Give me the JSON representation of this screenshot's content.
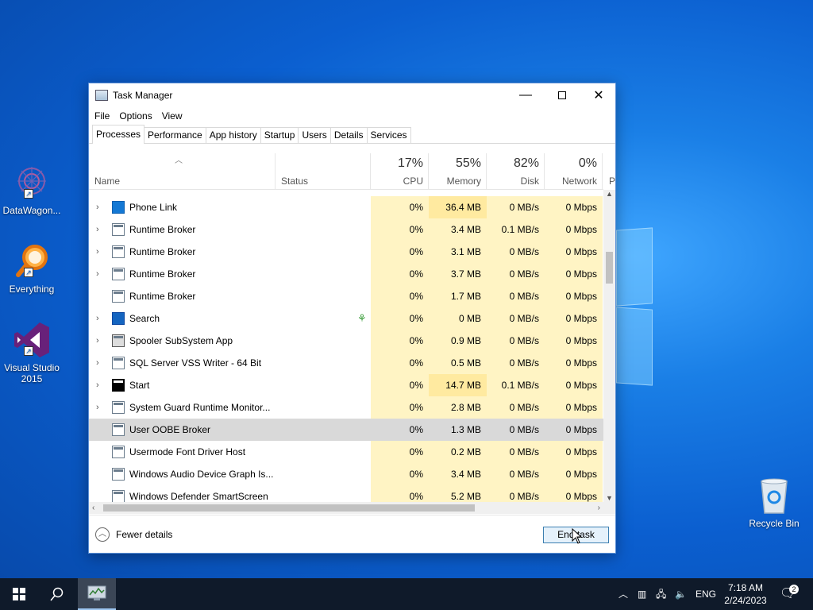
{
  "desktop": {
    "icons": [
      {
        "label": "DataWagon...",
        "icon": "datawagon-icon"
      },
      {
        "label": "Everything",
        "icon": "everything-search-icon"
      },
      {
        "label": "Visual Studio 2015",
        "icon": "visual-studio-icon"
      },
      {
        "label": "Recycle Bin",
        "icon": "recycle-bin-icon"
      }
    ]
  },
  "window": {
    "title": "Task Manager",
    "menu": [
      "File",
      "Options",
      "View"
    ],
    "tabs": [
      "Processes",
      "Performance",
      "App history",
      "Startup",
      "Users",
      "Details",
      "Services"
    ],
    "active_tab": "Processes",
    "columns": {
      "name": "Name",
      "status": "Status",
      "cpu": {
        "pct": "17%",
        "label": "CPU"
      },
      "memory": {
        "pct": "55%",
        "label": "Memory"
      },
      "disk": {
        "pct": "82%",
        "label": "Disk"
      },
      "network": {
        "pct": "0%",
        "label": "Network"
      },
      "power_partial": "P"
    },
    "rows": [
      {
        "name": "Phone Link",
        "expand": true,
        "icon": "blue",
        "cpu": "0%",
        "memory": "36.4 MB",
        "disk": "0 MB/s",
        "network": "0 Mbps"
      },
      {
        "name": "Runtime Broker",
        "expand": true,
        "icon": "app",
        "cpu": "0%",
        "memory": "3.4 MB",
        "disk": "0.1 MB/s",
        "network": "0 Mbps"
      },
      {
        "name": "Runtime Broker",
        "expand": true,
        "icon": "app",
        "cpu": "0%",
        "memory": "3.1 MB",
        "disk": "0 MB/s",
        "network": "0 Mbps"
      },
      {
        "name": "Runtime Broker",
        "expand": true,
        "icon": "app",
        "cpu": "0%",
        "memory": "3.7 MB",
        "disk": "0 MB/s",
        "network": "0 Mbps"
      },
      {
        "name": "Runtime Broker",
        "expand": false,
        "icon": "app",
        "cpu": "0%",
        "memory": "1.7 MB",
        "disk": "0 MB/s",
        "network": "0 Mbps"
      },
      {
        "name": "Search",
        "expand": true,
        "icon": "search",
        "status_icon": "leaf",
        "cpu": "0%",
        "memory": "0 MB",
        "disk": "0 MB/s",
        "network": "0 Mbps"
      },
      {
        "name": "Spooler SubSystem App",
        "expand": true,
        "icon": "printer",
        "cpu": "0%",
        "memory": "0.9 MB",
        "disk": "0 MB/s",
        "network": "0 Mbps"
      },
      {
        "name": "SQL Server VSS Writer - 64 Bit",
        "expand": true,
        "icon": "app",
        "cpu": "0%",
        "memory": "0.5 MB",
        "disk": "0 MB/s",
        "network": "0 Mbps"
      },
      {
        "name": "Start",
        "expand": true,
        "icon": "start",
        "cpu": "0%",
        "memory": "14.7 MB",
        "disk": "0.1 MB/s",
        "network": "0 Mbps"
      },
      {
        "name": "System Guard Runtime Monitor...",
        "expand": true,
        "icon": "app",
        "cpu": "0%",
        "memory": "2.8 MB",
        "disk": "0 MB/s",
        "network": "0 Mbps"
      },
      {
        "name": "User OOBE Broker",
        "expand": false,
        "icon": "app",
        "selected": true,
        "cpu": "0%",
        "memory": "1.3 MB",
        "disk": "0 MB/s",
        "network": "0 Mbps"
      },
      {
        "name": "Usermode Font Driver Host",
        "expand": false,
        "icon": "app",
        "cpu": "0%",
        "memory": "0.2 MB",
        "disk": "0 MB/s",
        "network": "0 Mbps"
      },
      {
        "name": "Windows Audio Device Graph Is...",
        "expand": false,
        "icon": "app",
        "cpu": "0%",
        "memory": "3.4 MB",
        "disk": "0 MB/s",
        "network": "0 Mbps"
      },
      {
        "name": "Windows Defender SmartScreen",
        "expand": false,
        "icon": "app",
        "cpu": "0%",
        "memory": "5.2 MB",
        "disk": "0 MB/s",
        "network": "0 Mbps"
      }
    ],
    "footer": {
      "fewer_details": "Fewer details",
      "end_task": "End task"
    }
  },
  "taskbar": {
    "language": "ENG",
    "time": "7:18 AM",
    "date": "2/24/2023",
    "notifications_count": "2"
  }
}
